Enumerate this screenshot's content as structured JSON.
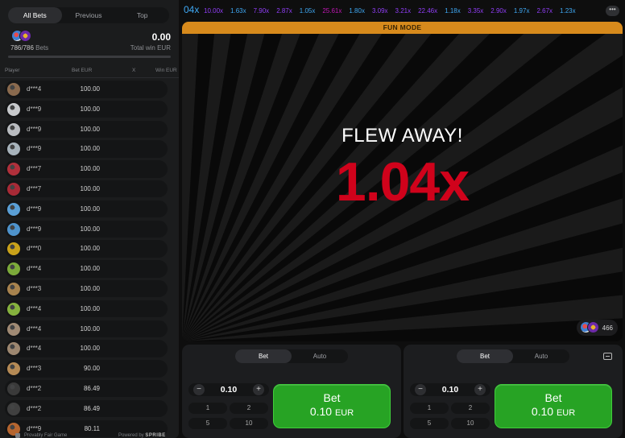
{
  "left_panel": {
    "tabs": [
      {
        "label": "All Bets",
        "active": true
      },
      {
        "label": "Previous",
        "active": false
      },
      {
        "label": "Top",
        "active": false
      }
    ],
    "summary": {
      "bets_count": "786/786",
      "bets_label": "Bets",
      "total_win": "0.00",
      "total_win_label": "Total win EUR",
      "progress_fraction": 1.0
    },
    "columns": {
      "player": "Player",
      "bet": "Bet EUR",
      "x": "X",
      "win": "Win EUR"
    },
    "rows": [
      {
        "player": "d***4",
        "bet": "100.00",
        "avatar_color": "#8a6a4e"
      },
      {
        "player": "d***9",
        "bet": "100.00",
        "avatar_color": "#c7c9cc"
      },
      {
        "player": "d***9",
        "bet": "100.00",
        "avatar_color": "#b9bcc0"
      },
      {
        "player": "d***9",
        "bet": "100.00",
        "avatar_color": "#a7b3bb"
      },
      {
        "player": "d***7",
        "bet": "100.00",
        "avatar_color": "#b0303b"
      },
      {
        "player": "d***7",
        "bet": "100.00",
        "avatar_color": "#a82a36"
      },
      {
        "player": "d***9",
        "bet": "100.00",
        "avatar_color": "#5a9fd6"
      },
      {
        "player": "d***9",
        "bet": "100.00",
        "avatar_color": "#4e93cc"
      },
      {
        "player": "d***0",
        "bet": "100.00",
        "avatar_color": "#c9a21a"
      },
      {
        "player": "d***4",
        "bet": "100.00",
        "avatar_color": "#7caa3a"
      },
      {
        "player": "d***3",
        "bet": "100.00",
        "avatar_color": "#a8834e"
      },
      {
        "player": "d***4",
        "bet": "100.00",
        "avatar_color": "#86b23e"
      },
      {
        "player": "d***4",
        "bet": "100.00",
        "avatar_color": "#a08a74"
      },
      {
        "player": "d***4",
        "bet": "100.00",
        "avatar_color": "#9d8770"
      },
      {
        "player": "d***3",
        "bet": "90.00",
        "avatar_color": "#b58a55"
      },
      {
        "player": "d***2",
        "bet": "86.49",
        "avatar_color": "#3a3a3a"
      },
      {
        "player": "d***2",
        "bet": "86.49",
        "avatar_color": "#404040"
      },
      {
        "player": "d***9",
        "bet": "80.11",
        "avatar_color": "#b5652f"
      }
    ],
    "footer": {
      "provably_fair": "Provably Fair Game",
      "powered_by": "Powered by",
      "brand": "SPRIBE"
    }
  },
  "history": {
    "first": "04x",
    "first_color": "#3fa9f5",
    "items": [
      {
        "value": "10.00x",
        "color": "#913ef8"
      },
      {
        "value": "1.63x",
        "color": "#3fa9f5"
      },
      {
        "value": "7.90x",
        "color": "#913ef8"
      },
      {
        "value": "2.87x",
        "color": "#913ef8"
      },
      {
        "value": "1.05x",
        "color": "#3fa9f5"
      },
      {
        "value": "25.61x",
        "color": "#c017b4"
      },
      {
        "value": "1.80x",
        "color": "#3fa9f5"
      },
      {
        "value": "3.09x",
        "color": "#913ef8"
      },
      {
        "value": "3.21x",
        "color": "#913ef8"
      },
      {
        "value": "22.46x",
        "color": "#913ef8"
      },
      {
        "value": "1.18x",
        "color": "#3fa9f5"
      },
      {
        "value": "3.35x",
        "color": "#913ef8"
      },
      {
        "value": "2.90x",
        "color": "#913ef8"
      },
      {
        "value": "1.97x",
        "color": "#3fa9f5"
      },
      {
        "value": "2.67x",
        "color": "#913ef8"
      },
      {
        "value": "1.23x",
        "color": "#3fa9f5"
      }
    ],
    "more_icon": "more-dots-icon",
    "more_label": "•••"
  },
  "stage": {
    "fun_mode": "FUN MODE",
    "flew_away": "FLEW AWAY!",
    "multiplier": "1.04x",
    "multiplier_color": "#d0021b",
    "online_count": "466"
  },
  "bet_panels": [
    {
      "tabs": [
        {
          "label": "Bet",
          "active": true
        },
        {
          "label": "Auto",
          "active": false
        }
      ],
      "amount": "0.10",
      "minus": "−",
      "plus": "+",
      "quick": [
        "1",
        "2",
        "5",
        "10"
      ],
      "button_label": "Bet",
      "button_amount": "0.10",
      "button_currency": "EUR",
      "chat_icon": false
    },
    {
      "tabs": [
        {
          "label": "Bet",
          "active": true
        },
        {
          "label": "Auto",
          "active": false
        }
      ],
      "amount": "0.10",
      "minus": "−",
      "plus": "+",
      "quick": [
        "1",
        "2",
        "5",
        "10"
      ],
      "button_label": "Bet",
      "button_amount": "0.10",
      "button_currency": "EUR",
      "chat_icon": true
    }
  ]
}
